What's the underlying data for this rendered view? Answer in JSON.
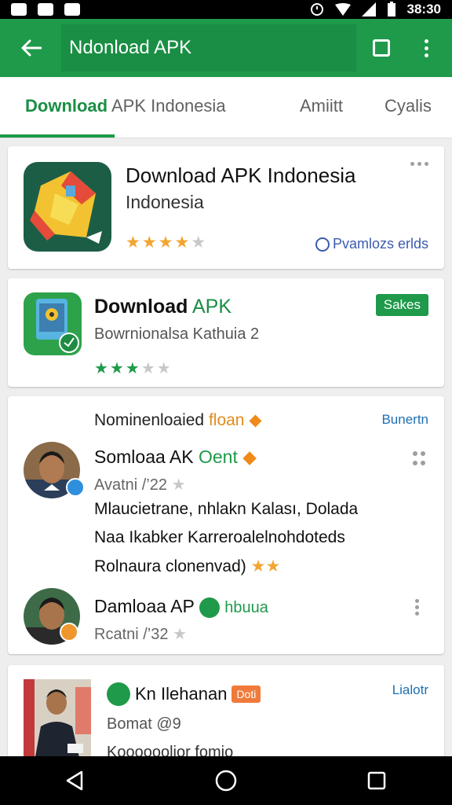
{
  "status_bar": {
    "time": "38:30"
  },
  "app_bar": {
    "title": "Ndonload APK"
  },
  "tabs": [
    {
      "label_strong": "Download",
      "label_rest": " APK Indonesia"
    },
    {
      "label": "Amiitt"
    },
    {
      "label": "Cyalis"
    }
  ],
  "featured_app": {
    "title": "Download APK Indonesia",
    "subtitle": "Indonesia",
    "rating": 4,
    "max_rating": 5,
    "developer": "Pvamlozs erlds"
  },
  "app2": {
    "title_strong": "Download",
    "title_rest": " APK",
    "subtitle": "Bowrnionalsa Kathuia 2",
    "badge": "Sakes",
    "rating": 3,
    "max_rating": 5
  },
  "reviews_section": {
    "title": "Nominenloaied",
    "title_tag": "floan",
    "link": "Bunertn",
    "reviews": [
      {
        "name": "Somloaa AK",
        "tag": "Oent",
        "meta": "Avatni /’22",
        "lines": [
          "Mlaucietrane, nhlakn Kalası, Dolada",
          "Naa Ikabker Karreroalelnohdoteds",
          "Rolnaura clonenvad)"
        ]
      },
      {
        "name": "Damloaa AP",
        "tag": "hbuua",
        "meta": "Rcatni /’32"
      }
    ]
  },
  "card4": {
    "name": "Kn Ilehanan",
    "badge": "Doti",
    "meta": "Bomat @9",
    "extra": "Koooooolior fomio",
    "link": "Lialotr"
  },
  "colors": {
    "primary": "#1e9a4a",
    "star": "#f3a531",
    "link": "#1f6fb2"
  }
}
